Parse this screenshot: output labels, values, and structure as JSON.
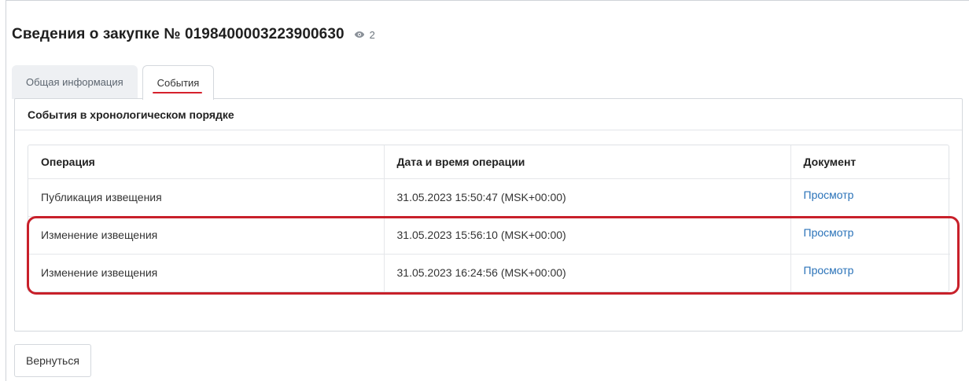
{
  "header": {
    "title": "Сведения о закупке № 0198400003223900630",
    "view_count": "2",
    "view_icon": "eye-icon"
  },
  "tabs": [
    {
      "label": "Общая информация",
      "active": false
    },
    {
      "label": "События",
      "active": true
    }
  ],
  "panel": {
    "title": "События в хронологическом порядке"
  },
  "events_table": {
    "columns": [
      "Операция",
      "Дата и время операции",
      "Документ"
    ],
    "rows": [
      {
        "operation": "Публикация извещения",
        "datetime": "31.05.2023 15:50:47 (MSK+00:00)",
        "document": "Просмотр"
      },
      {
        "operation": "Изменение извещения",
        "datetime": "31.05.2023 15:56:10 (MSK+00:00)",
        "document": "Просмотр"
      },
      {
        "operation": "Изменение извещения",
        "datetime": "31.05.2023 16:24:56 (MSK+00:00)",
        "document": "Просмотр"
      }
    ]
  },
  "footer": {
    "back_label": "Вернуться"
  },
  "colors": {
    "accent_red": "#d6212c",
    "link_blue": "#2b73b9",
    "highlight_red": "#c8202a"
  }
}
